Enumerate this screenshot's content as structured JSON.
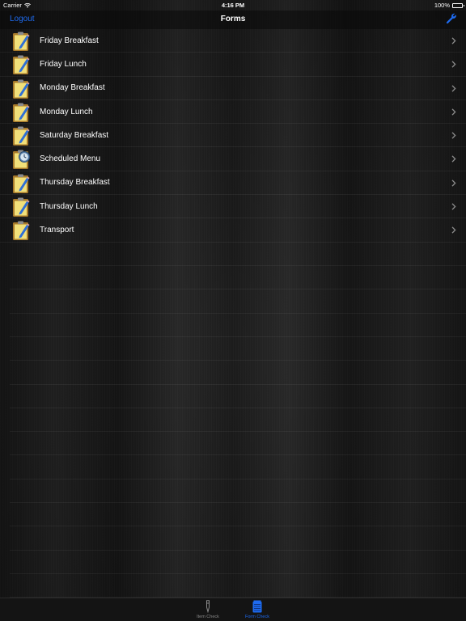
{
  "status_bar": {
    "carrier": "Carrier",
    "time": "4:16 PM",
    "battery": "100%"
  },
  "nav_bar": {
    "left_label": "Logout",
    "title": "Forms",
    "right_icon": "wrench-icon"
  },
  "forms": [
    {
      "label": "Friday Breakfast",
      "icon": "clipboard-pencil-icon"
    },
    {
      "label": "Friday Lunch",
      "icon": "clipboard-pencil-icon"
    },
    {
      "label": "Monday Breakfast",
      "icon": "clipboard-pencil-icon"
    },
    {
      "label": "Monday Lunch",
      "icon": "clipboard-pencil-icon"
    },
    {
      "label": "Saturday Breakfast",
      "icon": "clipboard-pencil-icon"
    },
    {
      "label": "Scheduled Menu",
      "icon": "clipboard-clock-icon"
    },
    {
      "label": "Thursday Breakfast",
      "icon": "clipboard-pencil-icon"
    },
    {
      "label": "Thursday Lunch",
      "icon": "clipboard-pencil-icon"
    },
    {
      "label": "Transport",
      "icon": "clipboard-pencil-icon"
    }
  ],
  "tab_bar": {
    "items": [
      {
        "label": "Item Check",
        "icon": "pen-icon",
        "selected": false
      },
      {
        "label": "Form Check",
        "icon": "notepad-icon",
        "selected": true
      }
    ]
  },
  "colors": {
    "accent": "#1e6bf0",
    "background": "#1c1c1c",
    "text": "#ffffff"
  }
}
